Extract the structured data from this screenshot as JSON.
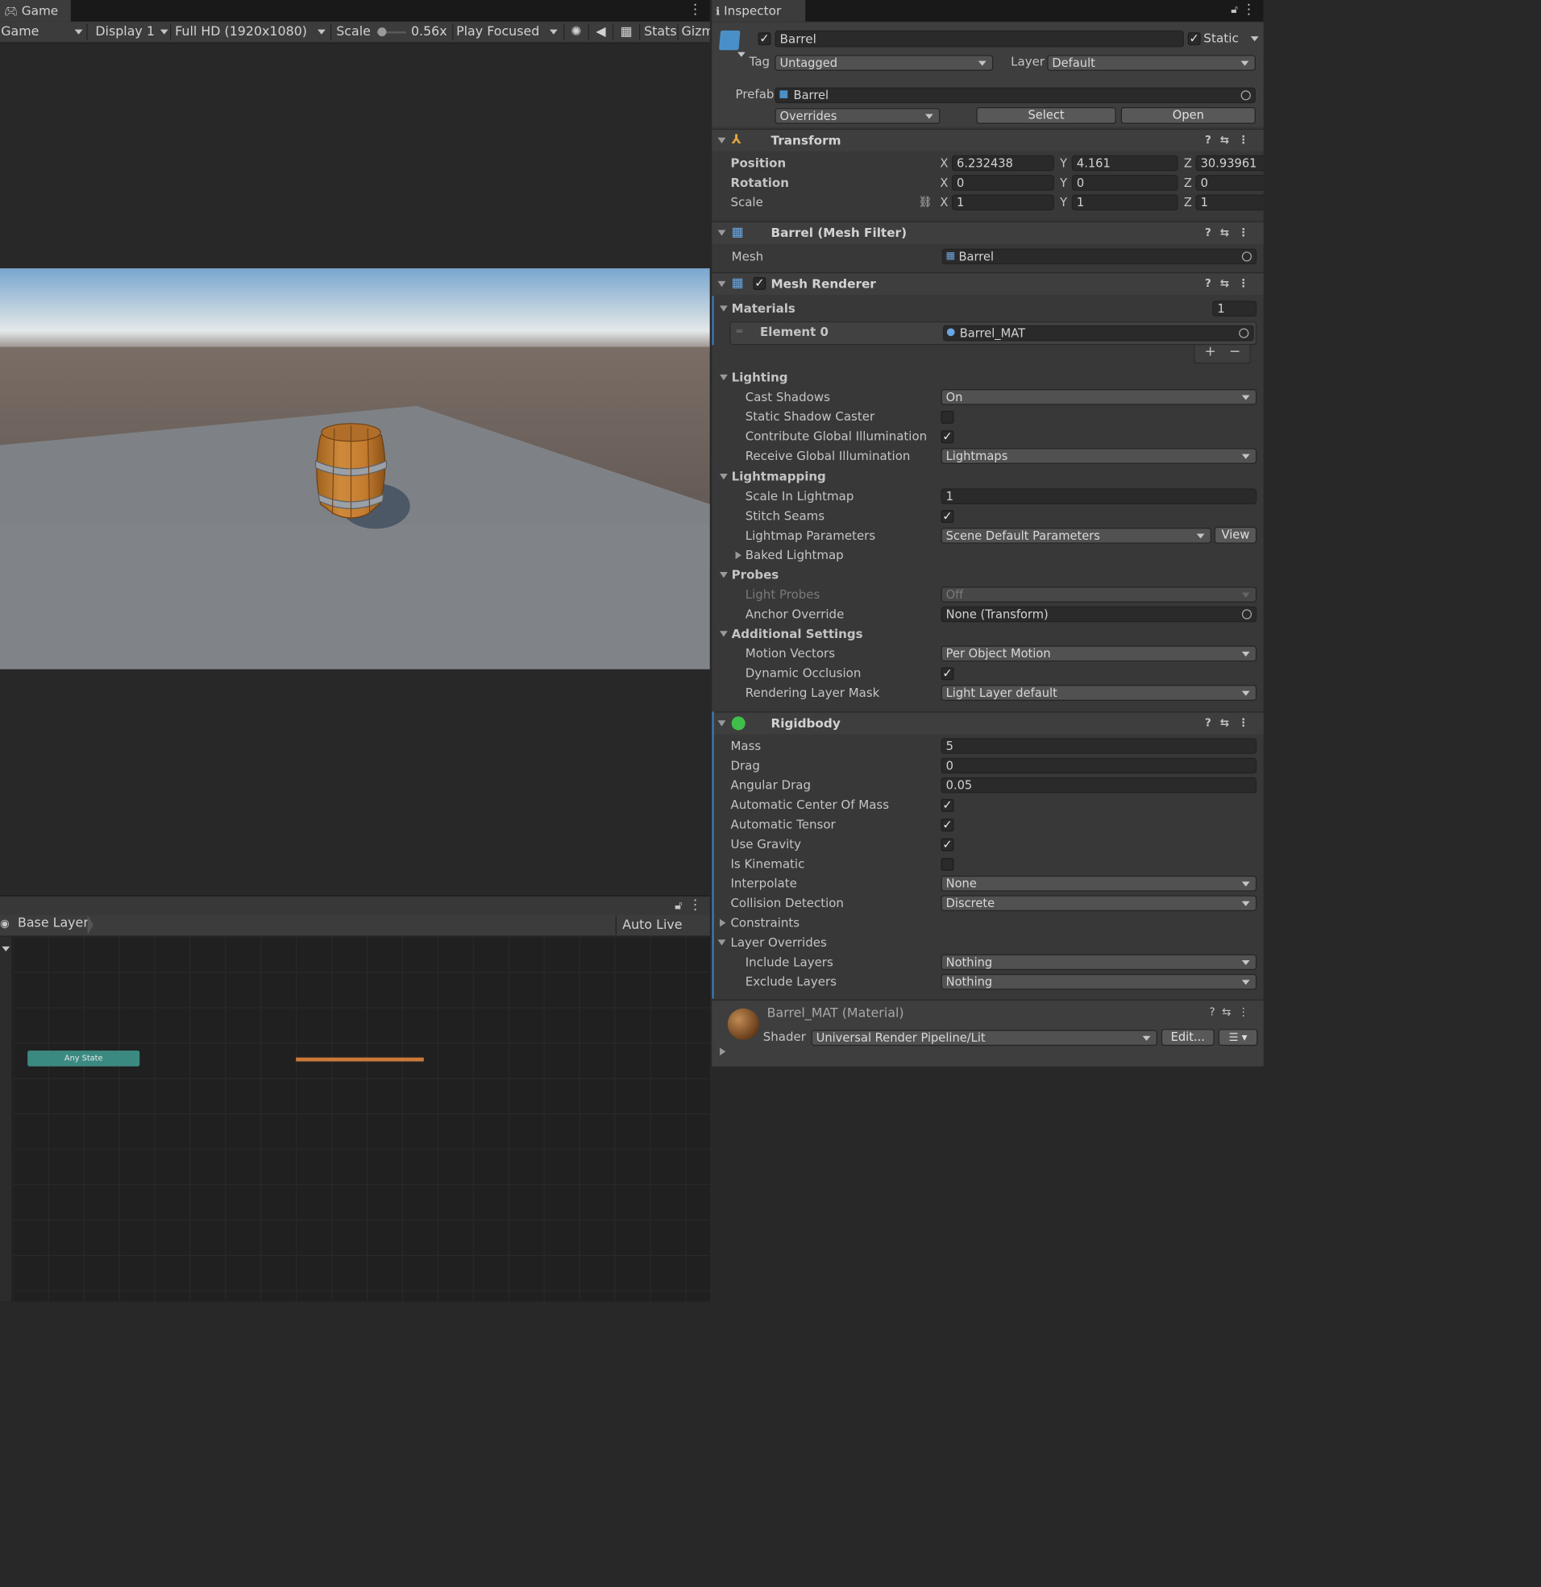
{
  "game": {
    "tab_label": "Game",
    "mode_label": "Game",
    "display_label": "Display 1",
    "resolution_label": "Full HD (1920x1080)",
    "scale_label": "Scale",
    "scale_value": "0.56x",
    "scale_slider_fraction": 0.1,
    "play_mode_label": "Play Focused",
    "stats_label": "Stats",
    "gizmos_label": "Gizm"
  },
  "animator": {
    "breadcrumb": "Base Layer",
    "auto_live_link": "Auto Live Link",
    "any_state_label": "Any State"
  },
  "inspector": {
    "tab_label": "Inspector",
    "object": {
      "enabled": true,
      "name": "Barrel",
      "static_checked": true,
      "static_label": "Static",
      "tag_label": "Tag",
      "tag_value": "Untagged",
      "layer_label": "Layer",
      "layer_value": "Default",
      "prefab_label": "Prefab",
      "prefab_value": "Barrel",
      "overrides_label": "Overrides",
      "select_label": "Select",
      "open_label": "Open"
    },
    "transform": {
      "title": "Transform",
      "position_label": "Position",
      "rotation_label": "Rotation",
      "scale_label": "Scale",
      "axis_x": "X",
      "axis_y": "Y",
      "axis_z": "Z",
      "position": {
        "x": "6.232438",
        "y": "4.161",
        "z": "30.93961"
      },
      "rotation": {
        "x": "0",
        "y": "0",
        "z": "0"
      },
      "scale": {
        "x": "1",
        "y": "1",
        "z": "1"
      }
    },
    "mesh_filter": {
      "title": "Barrel (Mesh Filter)",
      "mesh_label": "Mesh",
      "mesh_value": "Barrel"
    },
    "mesh_renderer": {
      "title": "Mesh Renderer",
      "enabled": true,
      "materials_label": "Materials",
      "materials_count": "1",
      "element0_label": "Element 0",
      "element0_value": "Barrel_MAT",
      "add_label": "+",
      "remove_label": "−",
      "lighting_label": "Lighting",
      "cast_shadows_label": "Cast Shadows",
      "cast_shadows_value": "On",
      "static_shadow_caster_label": "Static Shadow Caster",
      "static_shadow_caster_checked": false,
      "contribute_gi_label": "Contribute Global Illumination",
      "contribute_gi_checked": true,
      "receive_gi_label": "Receive Global Illumination",
      "receive_gi_value": "Lightmaps",
      "lightmapping_label": "Lightmapping",
      "scale_in_lightmap_label": "Scale In Lightmap",
      "scale_in_lightmap_value": "1",
      "stitch_seams_label": "Stitch Seams",
      "stitch_seams_checked": true,
      "lightmap_params_label": "Lightmap Parameters",
      "lightmap_params_value": "Scene Default Parameters",
      "view_label": "View",
      "baked_lightmap_label": "Baked Lightmap",
      "probes_label": "Probes",
      "light_probes_label": "Light Probes",
      "light_probes_value": "Off",
      "anchor_override_label": "Anchor Override",
      "anchor_override_value": "None (Transform)",
      "additional_label": "Additional Settings",
      "motion_vectors_label": "Motion Vectors",
      "motion_vectors_value": "Per Object Motion",
      "dynamic_occlusion_label": "Dynamic Occlusion",
      "dynamic_occlusion_checked": true,
      "rendering_layer_label": "Rendering Layer Mask",
      "rendering_layer_value": "Light Layer default"
    },
    "rigidbody": {
      "title": "Rigidbody",
      "mass_label": "Mass",
      "mass_value": "5",
      "drag_label": "Drag",
      "drag_value": "0",
      "angular_drag_label": "Angular Drag",
      "angular_drag_value": "0.05",
      "auto_com_label": "Automatic Center Of Mass",
      "auto_com_checked": true,
      "auto_tensor_label": "Automatic Tensor",
      "auto_tensor_checked": true,
      "use_gravity_label": "Use Gravity",
      "use_gravity_checked": true,
      "is_kinematic_label": "Is Kinematic",
      "is_kinematic_checked": false,
      "interpolate_label": "Interpolate",
      "interpolate_value": "None",
      "collision_label": "Collision Detection",
      "collision_value": "Discrete",
      "constraints_label": "Constraints",
      "layer_overrides_label": "Layer Overrides",
      "include_label": "Include Layers",
      "include_value": "Nothing",
      "exclude_label": "Exclude Layers",
      "exclude_value": "Nothing"
    },
    "material": {
      "title": "Barrel_MAT (Material)",
      "shader_label": "Shader",
      "shader_value": "Universal Render Pipeline/Lit",
      "edit_label": "Edit..."
    }
  }
}
